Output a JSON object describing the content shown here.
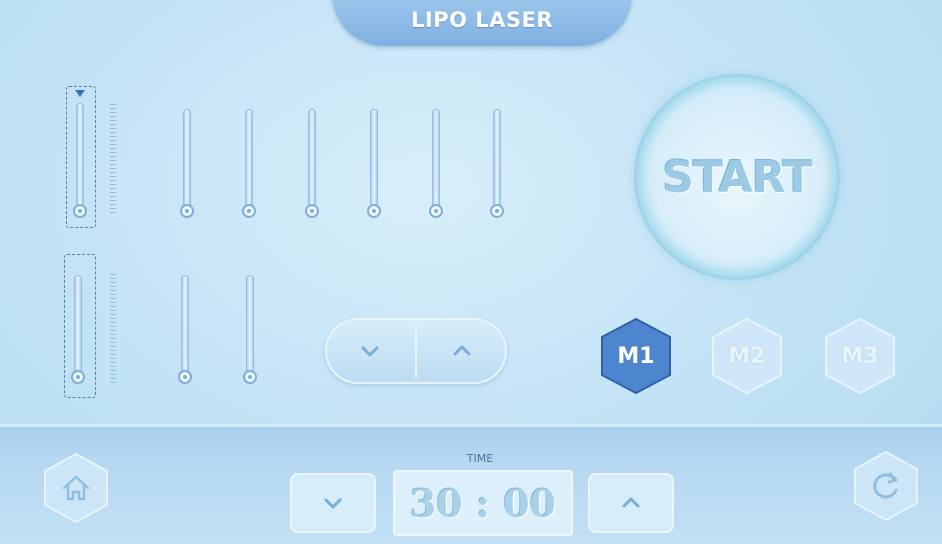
{
  "header": {
    "title": "LIPO LASER"
  },
  "sliders": {
    "top_row_count": 7,
    "bottom_row_count": 3,
    "top_row_levels": [
      0,
      0,
      0,
      0,
      0,
      0,
      0
    ],
    "bottom_row_levels": [
      0,
      0,
      0
    ]
  },
  "adjust": {
    "down_icon": "chevron-down-icon",
    "up_icon": "chevron-up-icon"
  },
  "start_button": {
    "label": "START"
  },
  "modes": [
    {
      "label": "M1",
      "selected": true
    },
    {
      "label": "M2",
      "selected": false
    },
    {
      "label": "M3",
      "selected": false
    }
  ],
  "timer": {
    "label": "TIME",
    "value": "30 : 00"
  },
  "footer": {
    "home_icon": "home-icon",
    "reset_icon": "refresh-icon"
  },
  "colors": {
    "accent": "#7fb0e2",
    "selected_mode": "#4d86cf",
    "background": "#c5e4f6"
  }
}
